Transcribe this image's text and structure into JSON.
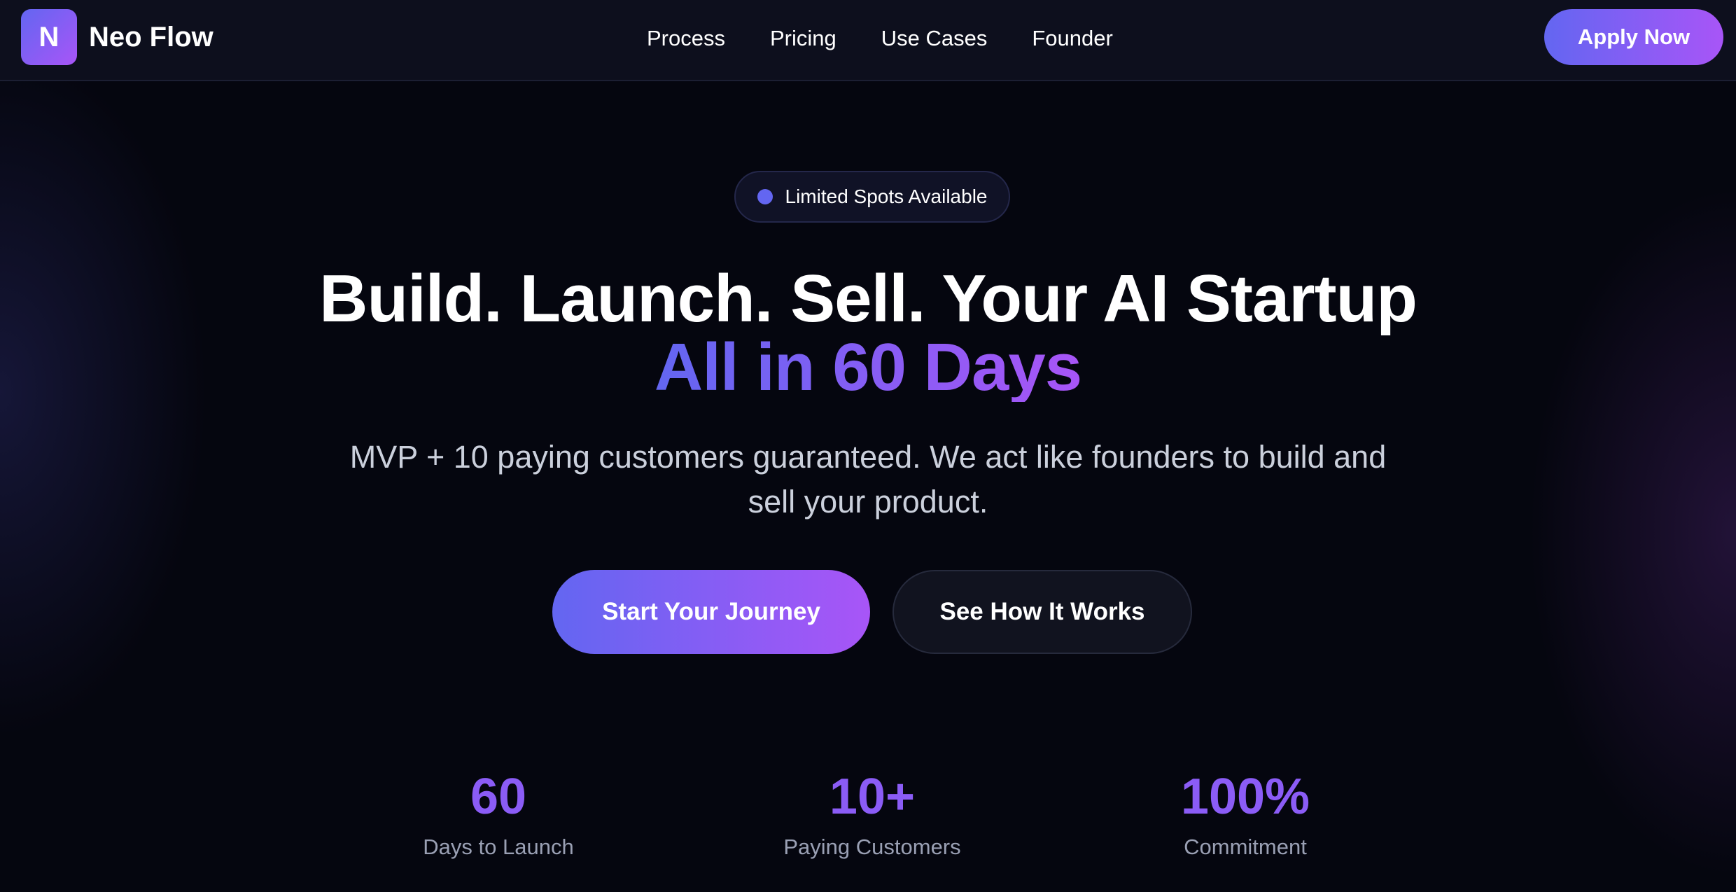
{
  "navbar": {
    "brand_initial": "N",
    "brand_name": "Neo Flow",
    "links": [
      {
        "label": "Process"
      },
      {
        "label": "Pricing"
      },
      {
        "label": "Use Cases"
      },
      {
        "label": "Founder"
      }
    ],
    "apply_label": "Apply Now"
  },
  "hero": {
    "badge_text": "Limited Spots Available",
    "headline_line1": "Build. Launch. Sell. Your AI Startup",
    "headline_line2": "All in 60 Days",
    "subheadline": "MVP + 10 paying customers guaranteed. We act like founders to build and sell your product.",
    "cta_primary": "Start Your Journey",
    "cta_secondary": "See How It Works"
  },
  "stats": [
    {
      "value": "60",
      "label": "Days to Launch"
    },
    {
      "value": "10+",
      "label": "Paying Customers"
    },
    {
      "value": "100%",
      "label": "Commitment"
    }
  ],
  "colors": {
    "background": "#05060f",
    "navbar_bg": "#0d0f1d",
    "accent_start": "#6366f1",
    "accent_end": "#a855f7",
    "stat_value": "#8b5cf6",
    "muted_text": "#9aa0b4"
  }
}
